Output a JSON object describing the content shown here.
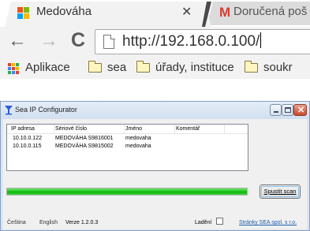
{
  "browser": {
    "active_tab": {
      "title": "Medováha",
      "close_icon": "close-icon"
    },
    "inactive_tab": {
      "title": "Doručená poš",
      "icon": "gmail-icon"
    },
    "toolbar": {
      "back_icon": "arrow-left-icon",
      "forward_icon": "arrow-right-icon",
      "reload_icon": "reload-icon",
      "url": "http://192.168.0.100/"
    },
    "bookmarks": [
      {
        "label": "Aplikace",
        "icon": "apps-grid-icon"
      },
      {
        "label": "sea",
        "icon": "folder-icon"
      },
      {
        "label": "úřady, instituce",
        "icon": "folder-icon"
      },
      {
        "label": "soukr",
        "icon": "folder-icon"
      }
    ]
  },
  "window": {
    "title": "Sea IP Configurator",
    "buttons": {
      "minimize": "minimize-icon",
      "maximize": "maximize-icon",
      "close": "close-icon"
    },
    "list": {
      "columns": [
        "IP adresa",
        "Sériové číslo",
        "Jméno",
        "Komentář"
      ],
      "rows": [
        [
          "10.10.0.122",
          "MEDOVÁHA S9816001",
          "medovaha",
          ""
        ],
        [
          "10.10.0.115",
          "MEDOVÁHA S9815002",
          "medovaha",
          ""
        ]
      ]
    },
    "progress": 1.0,
    "scan_button": "Spustit scan",
    "footer": {
      "language_cs": "Čeština",
      "language_en": "English",
      "version": "Verze 1.2.0.3",
      "debug_label": "Ladění",
      "debug_checked": false,
      "link": "Stránky SEA spol. s r.o."
    }
  },
  "colors": {
    "progress_green": "#16c316",
    "link_blue": "#1a5dab",
    "gmail_red": "#d23f31"
  }
}
